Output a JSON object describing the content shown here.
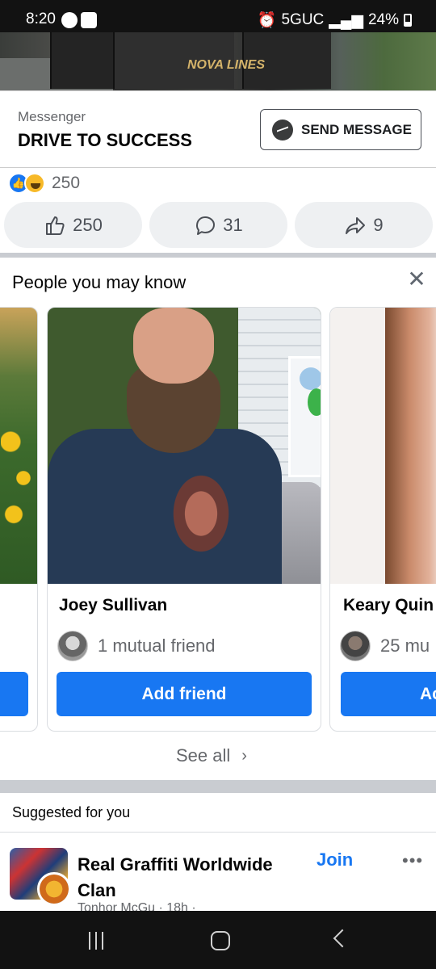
{
  "status_bar": {
    "time": "8:20",
    "network": "5GUC",
    "battery": "24%"
  },
  "post": {
    "truck_logo": "NOVA LINES",
    "cta_small": "Messenger",
    "cta_title": "DRIVE TO SUCCESS",
    "send_button": "SEND MESSAGE",
    "reaction_count": "250",
    "like_count": "250",
    "comment_count": "31",
    "share_count": "9"
  },
  "pymk": {
    "title": "People you may know",
    "cards": [
      {
        "name": "Joey Sullivan",
        "mutual": "1 mutual friend",
        "button": "Add friend"
      },
      {
        "name": "Keary Quin",
        "mutual": "25 mu",
        "button": "Ac"
      }
    ],
    "see_all": "See all"
  },
  "suggested": {
    "label": "Suggested for you",
    "group_name": "Real Graffiti Worldwide Clan",
    "subline": "Tonhor McGu · 18h ·",
    "join_label": "Join",
    "more": "•••"
  },
  "colors": {
    "accent": "#1877f2",
    "separator": "#c9ccd1",
    "status_bar": "#121212"
  }
}
